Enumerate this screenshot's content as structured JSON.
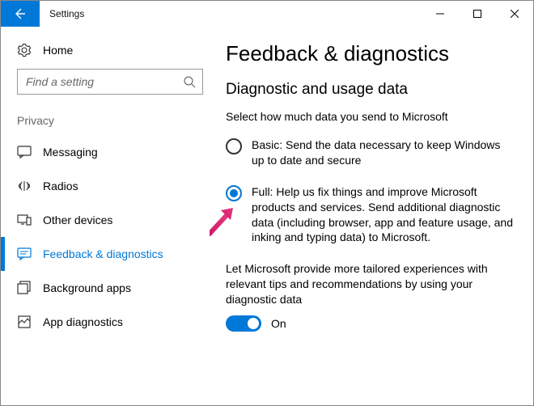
{
  "window": {
    "title": "Settings"
  },
  "sidebar": {
    "home_label": "Home",
    "search_placeholder": "Find a setting",
    "group_label": "Privacy",
    "items": [
      {
        "label": "Messaging"
      },
      {
        "label": "Radios"
      },
      {
        "label": "Other devices"
      },
      {
        "label": "Feedback & diagnostics"
      },
      {
        "label": "Background apps"
      },
      {
        "label": "App diagnostics"
      }
    ]
  },
  "main": {
    "heading": "Feedback & diagnostics",
    "subheading": "Diagnostic and usage data",
    "description": "Select how much data you send to Microsoft",
    "radios": {
      "basic": "Basic: Send the data necessary to keep Windows up to date and secure",
      "full": "Full: Help us fix things and improve Microsoft products and services. Send additional diagnostic data (including browser, app and feature usage, and inking and typing data) to Microsoft."
    },
    "tailored_text": "Let Microsoft provide more tailored experiences with relevant tips and recommendations by using your diagnostic data",
    "toggle_label": "On"
  }
}
